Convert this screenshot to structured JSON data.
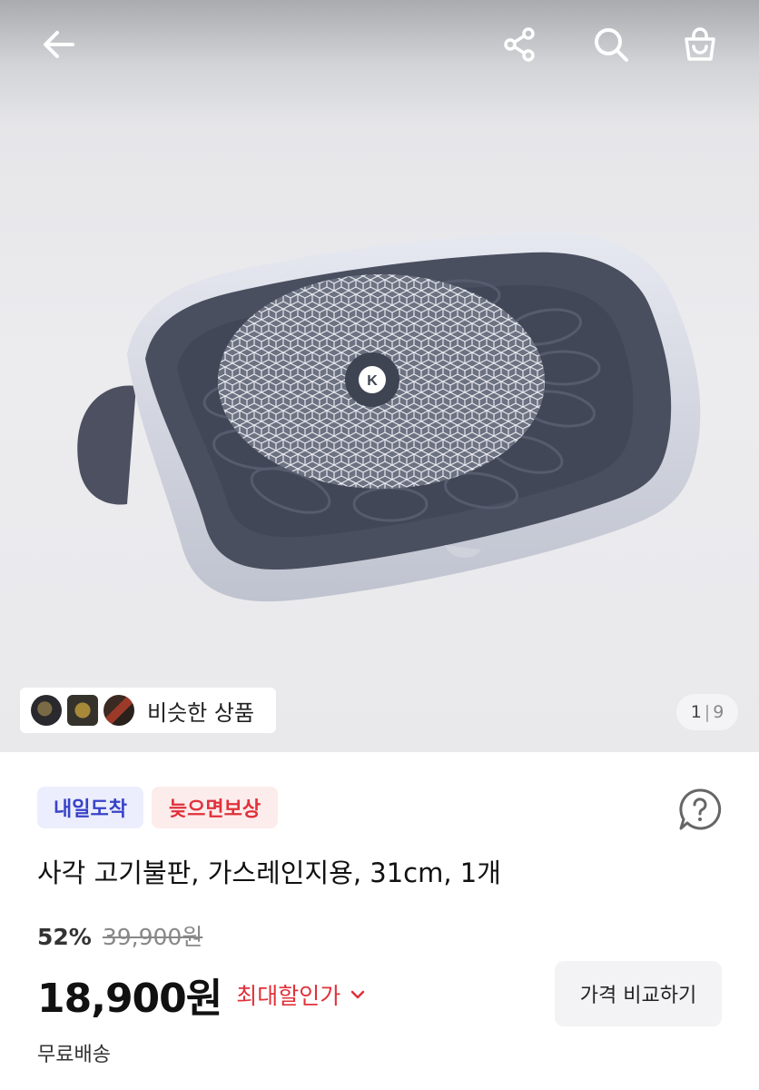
{
  "header": {
    "icons": [
      "back-arrow-icon",
      "share-icon",
      "search-icon",
      "shopping-bag-icon"
    ]
  },
  "image": {
    "logo_letter": "K",
    "similar_products_label": "비슷한 상품",
    "pager": {
      "current": "1",
      "total": "9"
    }
  },
  "badges": {
    "arrival": "내일도착",
    "late_compensation": "늦으면보상"
  },
  "product": {
    "title": "사각 고기불판, 가스레인지용, 31cm, 1개",
    "discount_rate": "52%",
    "original_price": "39,900원",
    "price": "18,900원",
    "max_discount_label": "최대할인가",
    "compare_button": "가격 비교하기",
    "shipping": "무료배송"
  },
  "colors": {
    "accent_blue": "#3843c8",
    "accent_red": "#e0313a"
  }
}
